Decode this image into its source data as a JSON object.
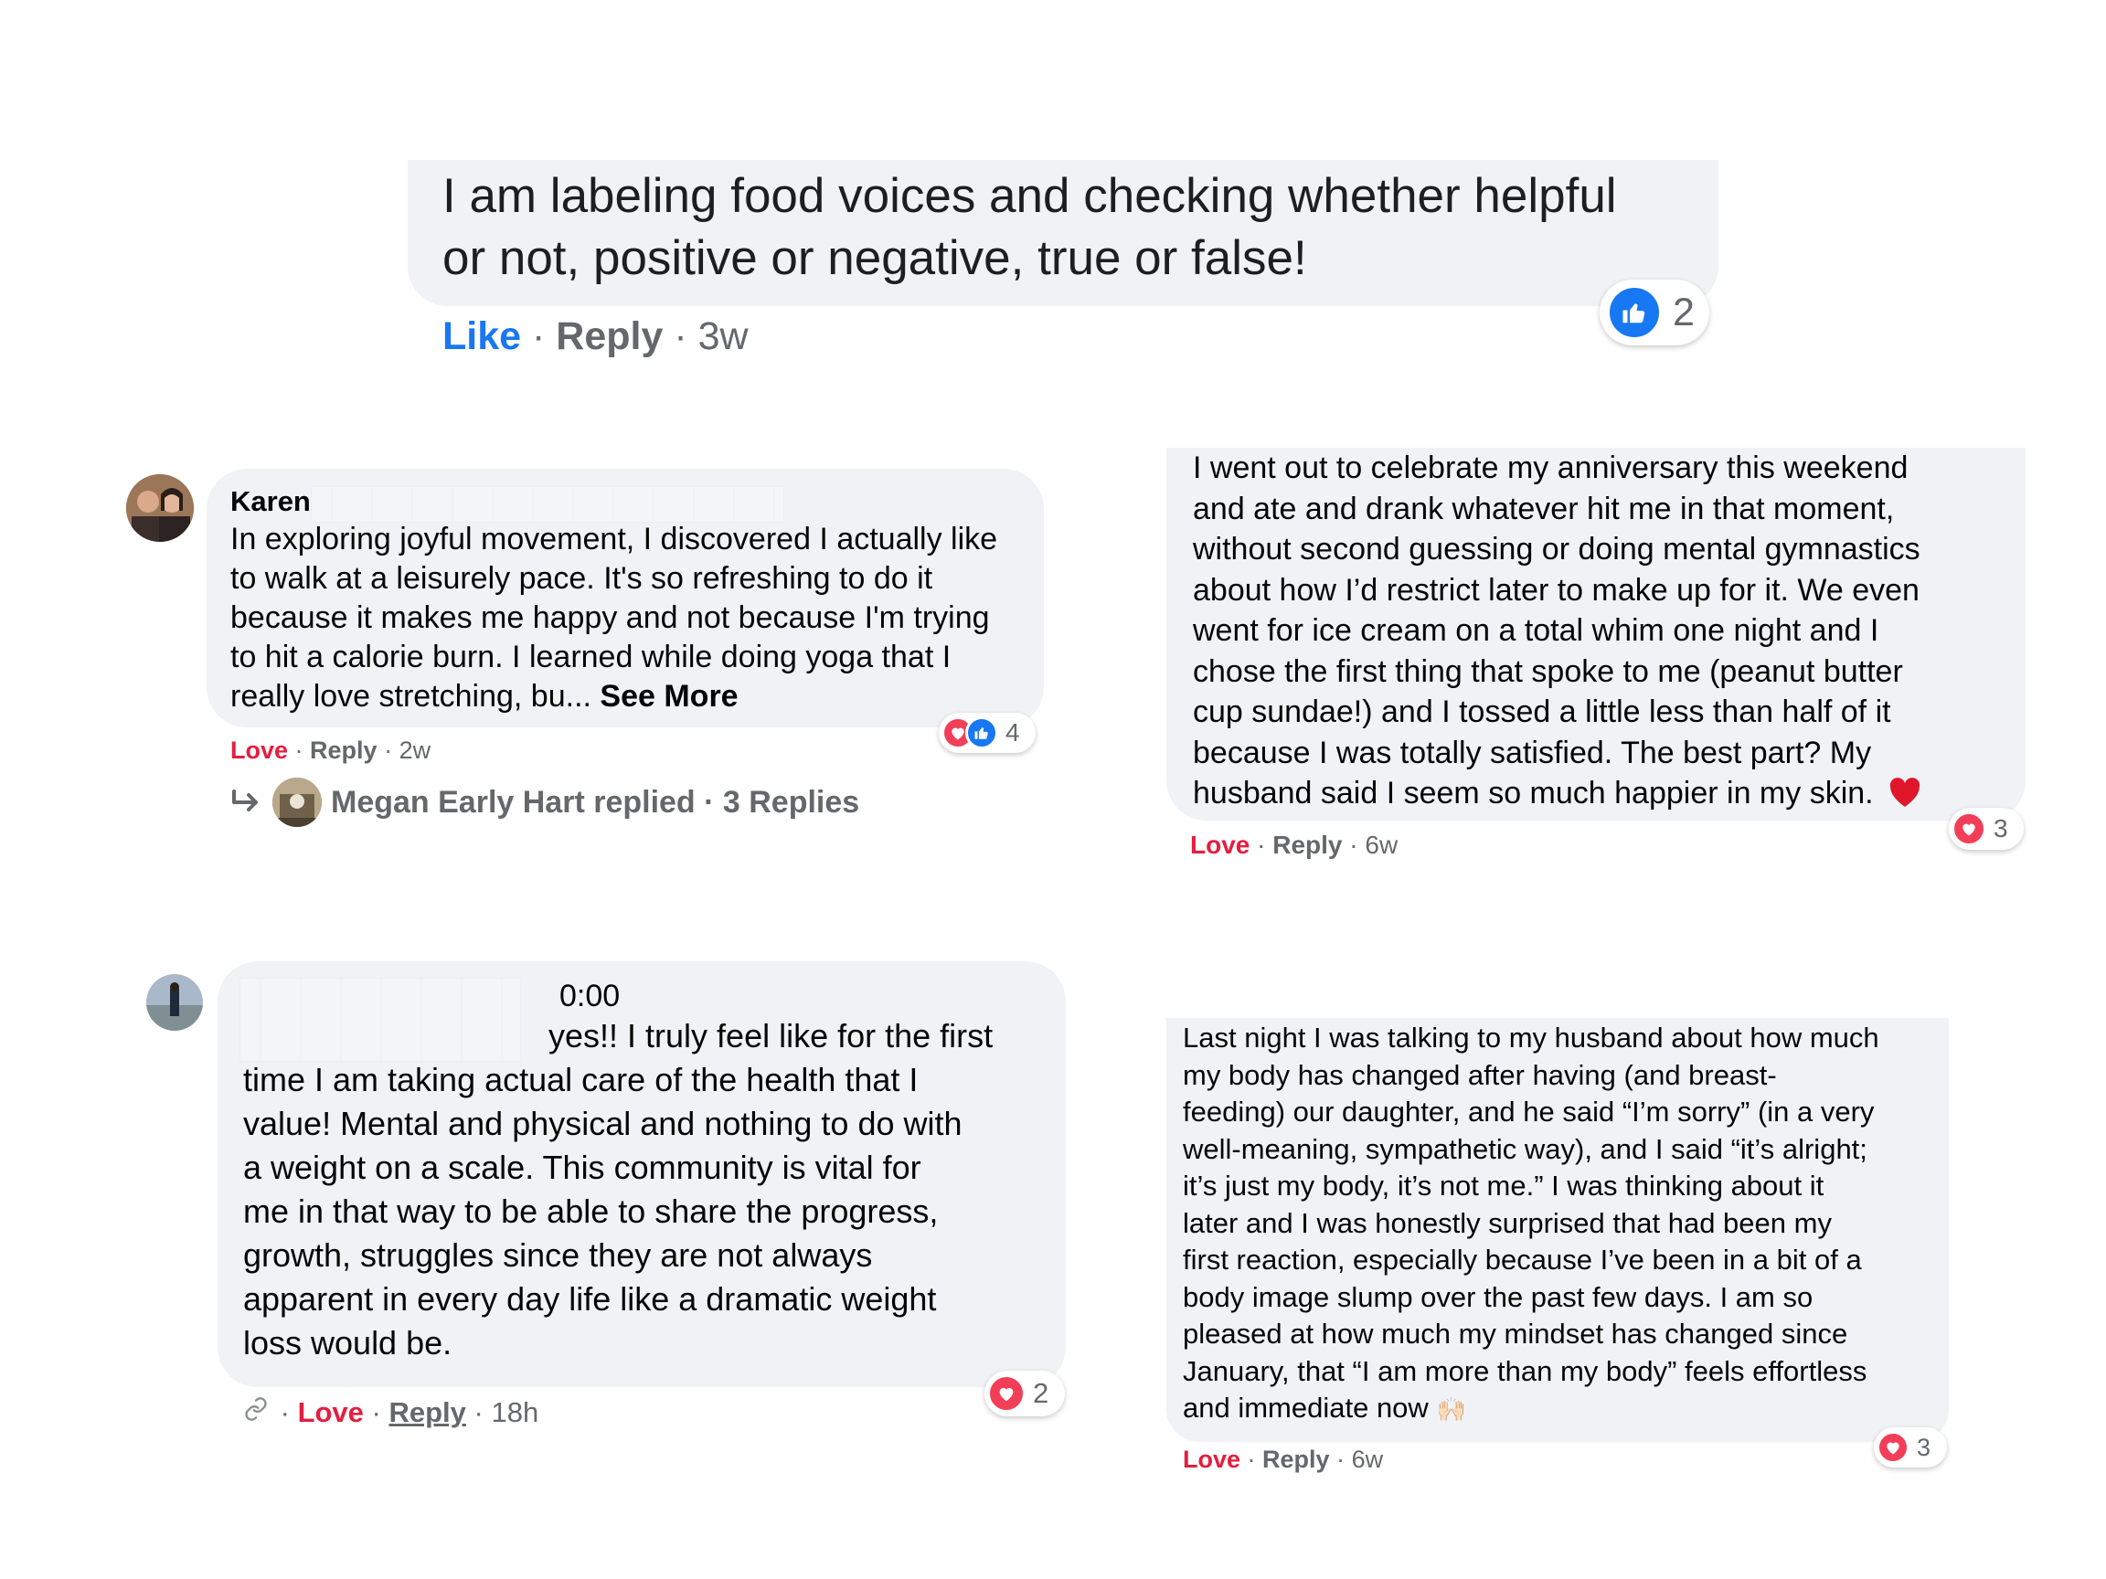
{
  "comment1": {
    "text": "I am labeling food voices and checking whether helpful\nor not, positive or negative, true or false!",
    "like": "Like",
    "reply": "Reply",
    "time": "3w",
    "reaction_count": "2"
  },
  "comment2": {
    "author": "Karen",
    "text": "In exploring joyful movement, I discovered I actually like\nto walk at a leisurely pace. It's so refreshing to do it\nbecause it makes me happy and not because I'm trying\nto hit a calorie burn. I learned while doing yoga that I\nreally love stretching, bu...",
    "see_more": "See More",
    "love": "Love",
    "reply": "Reply",
    "time": "2w",
    "reaction_count": "4",
    "replies_text": "Megan Early Hart replied · 3 Replies"
  },
  "comment3": {
    "text": "I went out to celebrate my anniversary this weekend\nand ate and drank whatever hit me in that moment,\nwithout second guessing or doing mental gymnastics\nabout how I’d restrict later to make up for it. We even\nwent for ice cream on a total whim one night and I\nchose the first thing that spoke to me (peanut butter\ncup sundae!) and I tossed a little less than half of it\nbecause I was totally satisfied. The best part? My\nhusband said I seem so much happier in my skin.",
    "love": "Love",
    "reply": "Reply",
    "time": "6w",
    "reaction_count": "3"
  },
  "comment4": {
    "audio_time": "0:00",
    "text_first": "yes!! I truly feel like for the first",
    "text": "time I am taking actual care of the health that I\nvalue! Mental and physical and nothing to do with\na weight on a scale. This community is vital for\nme in that way to be able to share the progress,\ngrowth, struggles since they are not always\napparent in every day life like a dramatic weight\nloss would be.",
    "love": "Love",
    "reply": "Reply",
    "time": "18h",
    "reaction_count": "2"
  },
  "comment5": {
    "text": "Last night I was talking to my husband about how much\nmy body has changed after having (and breast-\nfeeding) our daughter, and he said “I’m sorry” (in a very\nwell-meaning, sympathetic way), and I said “it’s alright;\nit’s just my body, it’s not me.” I was thinking about it\nlater and I was honestly surprised that had been my\nfirst reaction, especially because I’ve been in a bit of a\nbody image slump over the past few days. I am so\npleased at how much my mindset has changed since\nJanuary, that “I am more than my body” feels effortless\nand immediate now",
    "emoji": "🙌🏻",
    "love": "Love",
    "reply": "Reply",
    "time": "6w",
    "reaction_count": "3"
  },
  "icons": {
    "heart": "heart-reaction-icon",
    "thumb": "like-reaction-icon",
    "reply_arrow": "reply-arrow-icon",
    "link": "link-icon"
  },
  "colors": {
    "bubble": "#f0f2f5",
    "love": "#e41e3f",
    "like": "#1877f2",
    "meta": "#65676b"
  }
}
